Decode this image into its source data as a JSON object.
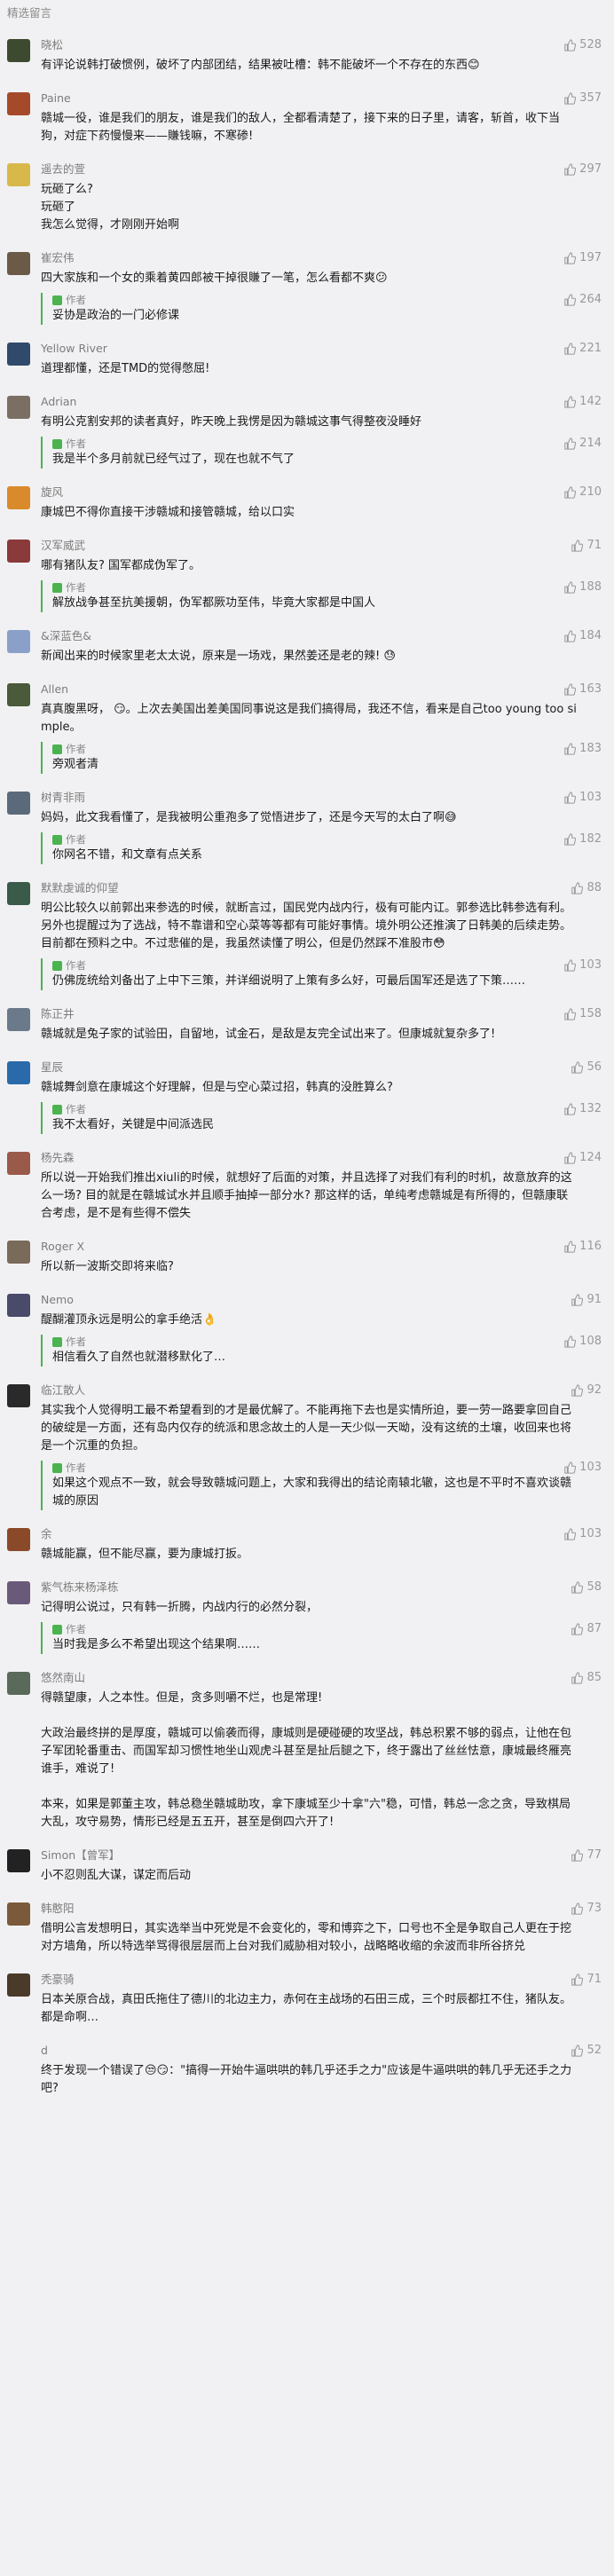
{
  "section_title": "精选留言",
  "comments": [
    {
      "name": "晓松",
      "likes": "528",
      "color": "#3d4a2f",
      "text": "有评论说韩打破惯例，破坏了内部团结，结果被吐槽：韩不能破坏一个不存在的东西😊",
      "reply": null
    },
    {
      "name": "Paine",
      "likes": "357",
      "color": "#a44a2a",
      "text": "赣城一役，谁是我们的朋友，谁是我们的敌人，全都看清楚了，接下来的日子里，请客，斩首，收下当狗，对症下药慢慢来——賺钱嘛，不寒碜!",
      "reply": null
    },
    {
      "name": "遥去的萱",
      "likes": "297",
      "color": "#d9b84a",
      "text": "玩砸了么?\n玩砸了\n我怎么觉得，才刚刚开始啊",
      "reply": null
    },
    {
      "name": "崔宏伟",
      "likes": "197",
      "color": "#6b5a48",
      "text": "四大家族和一个女的乘着黄四郎被干掉很賺了一笔，怎么看都不爽😕",
      "reply": {
        "label": "作者",
        "likes": "264",
        "text": "妥协是政治的一门必修课"
      }
    },
    {
      "name": "Yellow River",
      "likes": "221",
      "color": "#2f4a6a",
      "text": "道理都懂，还是TMD的觉得憋屈!",
      "reply": null
    },
    {
      "name": "Adrian",
      "likes": "142",
      "color": "#7b6f64",
      "text": "有明公克割安邦的读者真好，昨天晚上我愣是因为赣城这事气得整夜没睡好",
      "reply": {
        "label": "作者",
        "likes": "214",
        "text": "我是半个多月前就已经气过了，现在也就不气了"
      }
    },
    {
      "name": "旋风",
      "likes": "210",
      "color": "#d98a2a",
      "text": "康城巴不得你直接干涉赣城和接管赣城，给以口实",
      "reply": null
    },
    {
      "name": "汉军威武",
      "likes": "71",
      "color": "#8a3a3a",
      "text": "哪有猪队友? 国军都成伪军了。",
      "reply": {
        "label": "作者",
        "likes": "188",
        "text": "解放战争甚至抗美援朝，伪军都厥功至伟，毕竟大家都是中国人"
      }
    },
    {
      "name": "&深蓝色&",
      "likes": "184",
      "color": "#8aa0c8",
      "text": "新闻出来的时候家里老太太说，原来是一场戏，果然姜还是老的辣! 😓",
      "reply": null
    },
    {
      "name": "Allen",
      "likes": "163",
      "color": "#4a5a3a",
      "text": "真真腹黑呀， 😏。上次去美国出差美国同事说这是我们搞得局，我还不信，看来是自己too young too simple。",
      "reply": {
        "label": "作者",
        "likes": "183",
        "text": "旁观者清"
      }
    },
    {
      "name": "树青非雨",
      "likes": "103",
      "color": "#5a6a7a",
      "text": "妈妈，此文我看懂了，是我被明公重孢多了觉悟进步了，还是今天写的太白了啊😅",
      "reply": {
        "label": "作者",
        "likes": "182",
        "text": "你网名不错，和文章有点关系"
      }
    },
    {
      "name": "默默虔诚的仰望",
      "likes": "88",
      "color": "#3a5a4a",
      "text": "明公比较久以前郭出来参选的时候，就断言过，国民党内战内行，极有可能内讧。郭参选比韩参选有利。另外也提醒过为了选战，特不靠谱和空心菜等等都有可能好事情。境外明公还推演了日韩美的后续走势。目前都在预料之中。不过悲催的是，我虽然读懂了明公，但是仍然踩不准股市😳",
      "reply": {
        "label": "作者",
        "likes": "103",
        "text": "仍佛庞统给刘备出了上中下三策，并详细说明了上策有多么好，可最后国军还是选了下策……"
      }
    },
    {
      "name": "陈正井",
      "likes": "158",
      "color": "#6a7a8a",
      "text": "赣城就是兔子家的试验田，自留地，试金石，是敌是友完全试出来了。但康城就复杂多了!",
      "reply": null
    },
    {
      "name": "星辰",
      "likes": "56",
      "color": "#2a6aaa",
      "text": "赣城舞剑意在康城这个好理解，但是与空心菜过招，韩真的没胜算么?",
      "reply": {
        "label": "作者",
        "likes": "132",
        "text": "我不太看好，关键是中间派选民"
      }
    },
    {
      "name": "杨先森",
      "likes": "124",
      "color": "#9a5a4a",
      "text": "所以说一开始我们推出xiuli的时候，就想好了后面的对策，并且选择了对我们有利的时机，故意放弃的这么一场? 目的就是在赣城试水并且顺手抽掉一部分水? 那这样的话，单纯考虑赣城是有所得的，但赣康联合考虑，是不是有些得不偿失",
      "reply": null
    },
    {
      "name": "Roger X",
      "likes": "116",
      "color": "#7a6a5a",
      "text": "所以新一波斯交即将来临?",
      "reply": null
    },
    {
      "name": "Nemo",
      "likes": "91",
      "color": "#4a4a6a",
      "text": "醍醐灌顶永远是明公的拿手绝活👌",
      "reply": {
        "label": "作者",
        "likes": "108",
        "text": "相信看久了自然也就潜移默化了…"
      }
    },
    {
      "name": "临江散人",
      "likes": "92",
      "color": "#2a2a2a",
      "text": "其实我个人觉得明工最不希望看到的才是最优解了。不能再拖下去也是实情所迫，要一劳一路要拿回自己的破绽是一方面，还有岛内仅存的统派和思念故土的人是一天少似一天呦，没有这统的土壤，收回来也将是一个沉重的负担。",
      "reply": {
        "label": "作者",
        "likes": "103",
        "text": "如果这个观点不一致，就会导致赣城问题上，大家和我得出的结论南辕北辙，这也是不平时不喜欢谈赣城的原因"
      }
    },
    {
      "name": "余",
      "likes": "103",
      "color": "#8a4a2a",
      "text": "赣城能赢，但不能尽赢，要为康城打扳。",
      "reply": null
    },
    {
      "name": "紫气栋来杨泽栋",
      "likes": "58",
      "color": "#6a5a7a",
      "text": "记得明公说过，只有韩一折腾，内战内行的必然分裂，",
      "reply": {
        "label": "作者",
        "likes": "87",
        "text": "当时我是多么不希望出现这个结果啊……"
      }
    },
    {
      "name": "悠然南山",
      "likes": "85",
      "color": "#5a6a5a",
      "text": "得赣望康，人之本性。但是，贪多则嚼不烂，也是常理!\n\n大政治最终拼的是厚度，赣城可以偷袭而得，康城则是硬碰硬的攻坚战，韩总积累不够的弱点，让他在包子军团轮番重击、而国军却习惯性地坐山观虎斗甚至是扯后腿之下，终于露出了丝丝怯意，康城最终雁亮谁手，难说了!\n\n本来，如果是郭董主攻，韩总稳坐赣城助攻，拿下康城至少十拿\"六\"稳，可惜，韩总一念之贪，导致棋局大乱，攻守易势，情形已经是五五开，甚至是倒四六开了!",
      "reply": null
    },
    {
      "name": "Simon【曾军】",
      "likes": "77",
      "color": "#222222",
      "text": "小不忍则乱大谋，谋定而后动",
      "reply": null
    },
    {
      "name": "韩憨阳",
      "likes": "73",
      "color": "#7a5a3a",
      "text": "借明公言发想明日，其实选举当中死党是不会变化的，零和博弈之下，口号也不全是争取自己人更在于挖对方墙角，所以特选举骂得很层层而上台对我们威胁相对较小，战略略收缩的余波而非所谷挤兑",
      "reply": null
    },
    {
      "name": "秃豪骑",
      "likes": "71",
      "color": "#4a3a2a",
      "text": "日本关原合战，真田氏拖住了德川的北边主力，赤何在主战场的石田三成，三个时辰都扛不住，猪队友。都是命啊…",
      "reply": null
    },
    {
      "name": "d",
      "likes": "52",
      "color": "#f1f1f3",
      "text": "终于发现一个错误了😒😏：\"搞得一开始牛逼哄哄的韩几乎还手之力\"应该是牛逼哄哄的韩几乎无还手之力吧?",
      "reply": null
    }
  ]
}
